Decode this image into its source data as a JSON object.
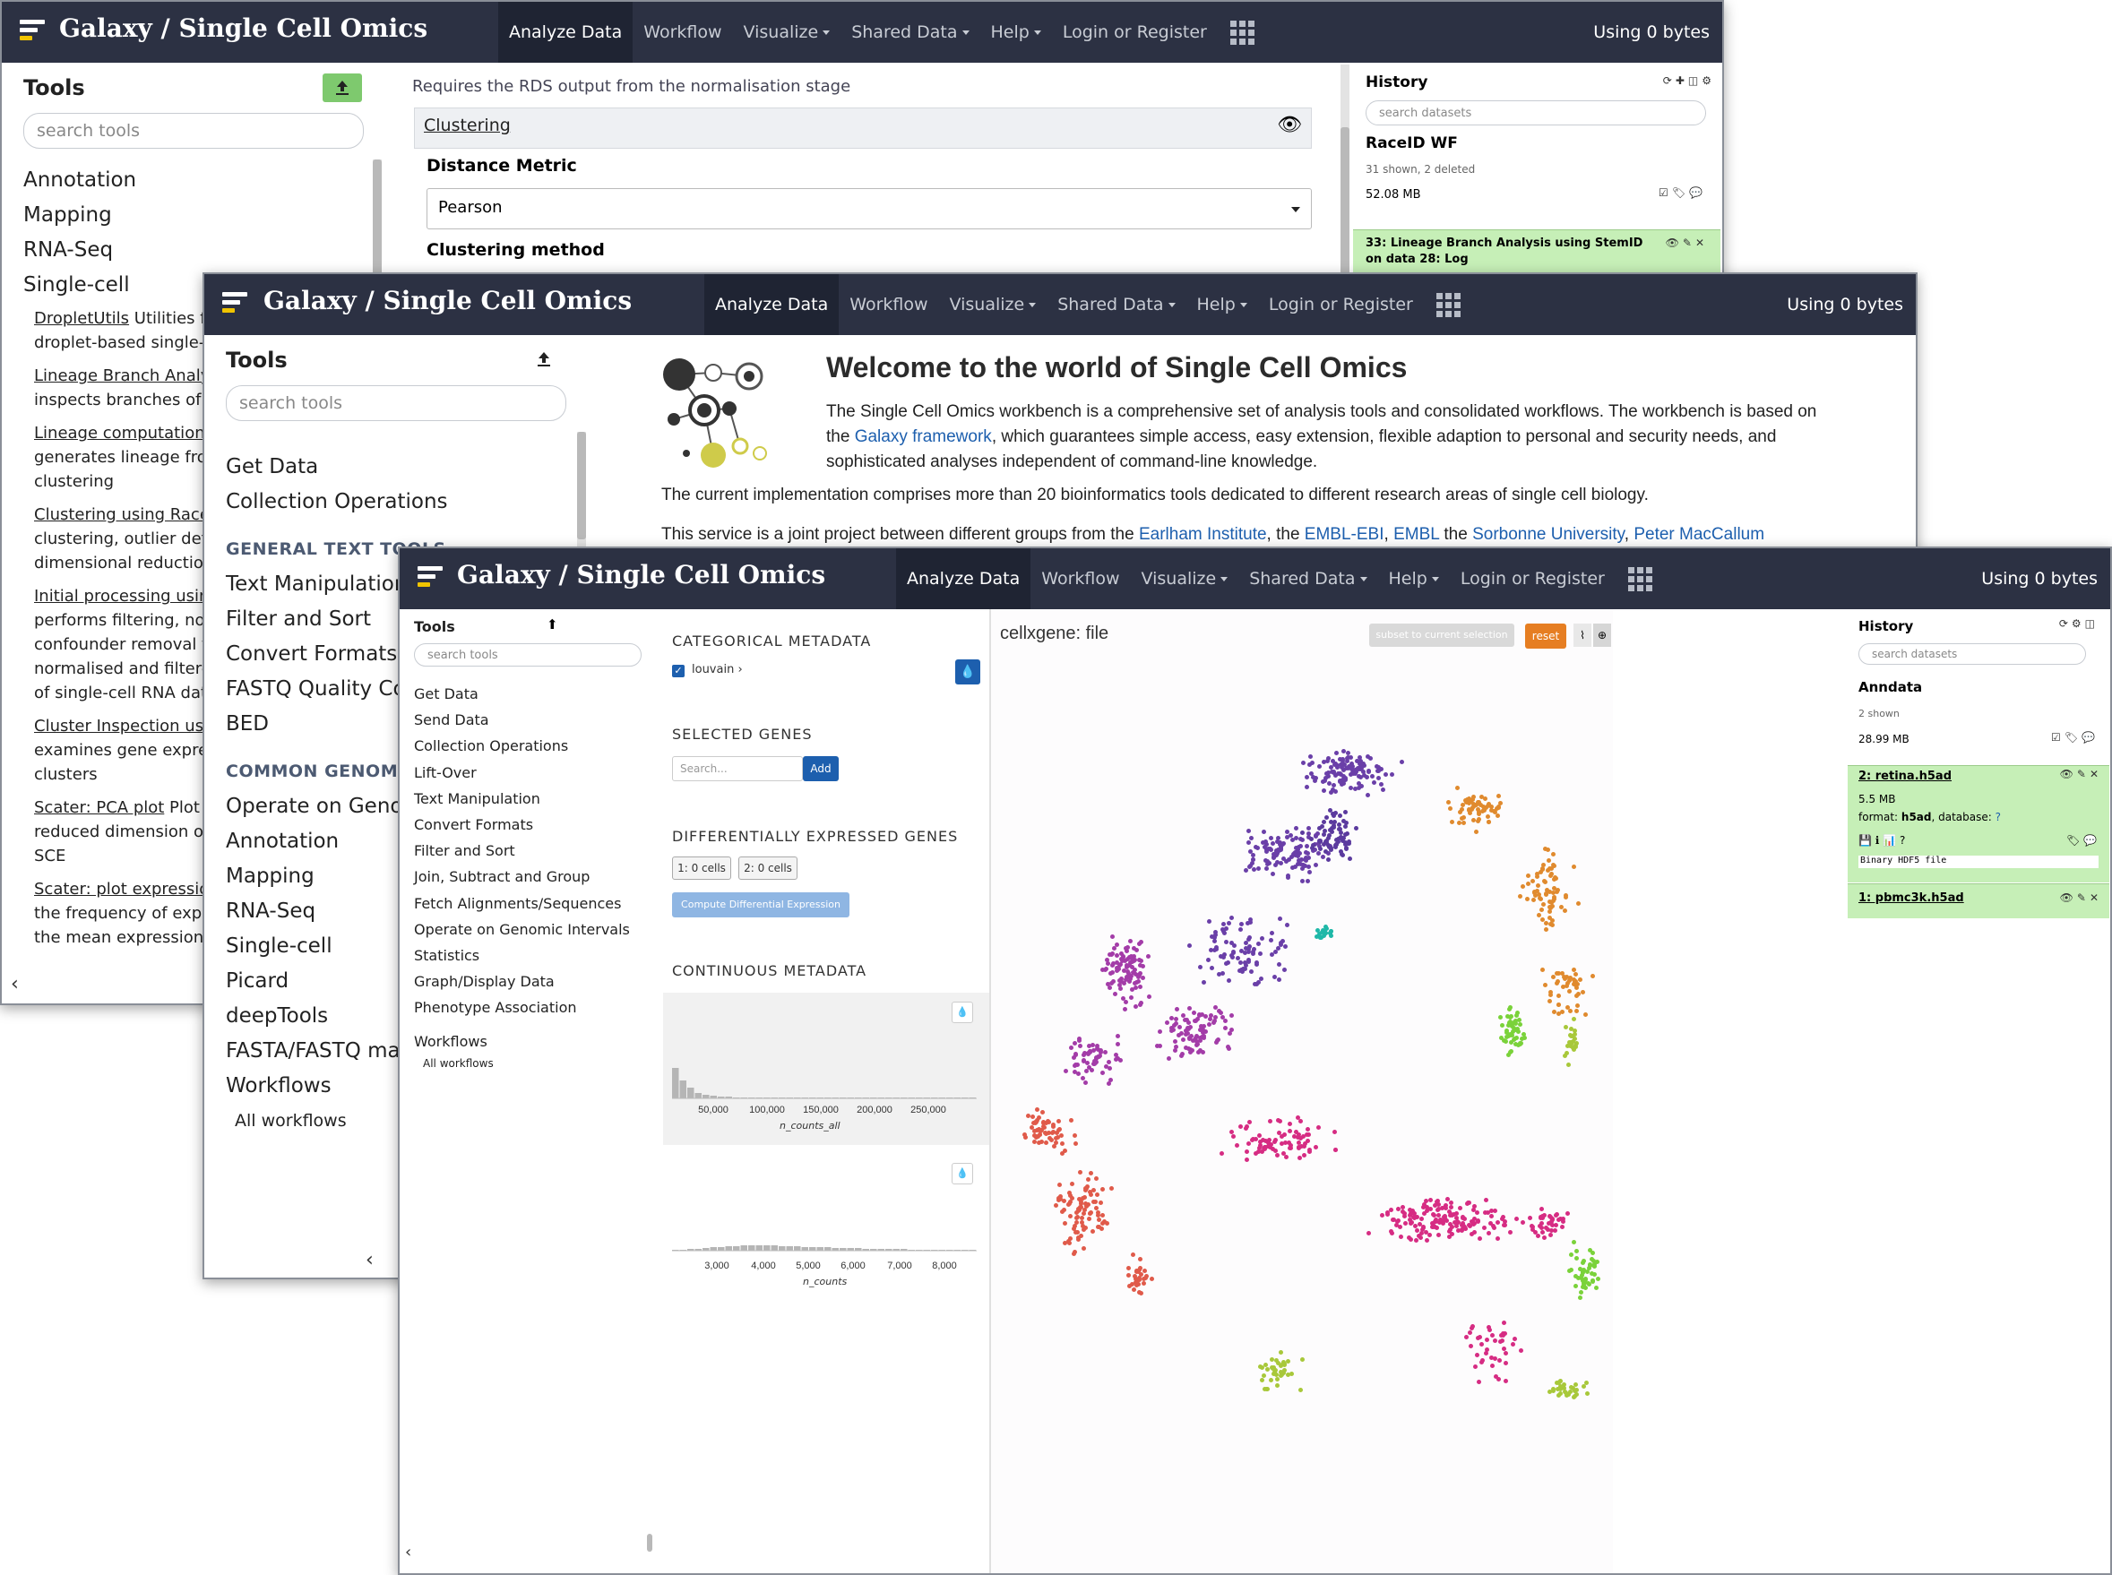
{
  "masthead": {
    "brand": "Galaxy / Single Cell Omics",
    "nav": [
      "Analyze Data",
      "Workflow",
      "Visualize",
      "Shared Data",
      "Help",
      "Login or Register"
    ],
    "using": "Using 0 bytes"
  },
  "colors": {
    "masthead": "#2c3143",
    "accent": "#1d5fae",
    "history_ok": "#c6efb7",
    "reset": "#e67e22"
  },
  "win1": {
    "tools_title": "Tools",
    "search_placeholder": "search tools",
    "categories": [
      "Annotation",
      "Mapping",
      "RNA-Seq",
      "Single-cell"
    ],
    "tools": [
      {
        "name": "DropletUtils",
        "desc1": " Utilities f",
        "desc2": "droplet-based single-c"
      },
      {
        "name": "Lineage Branch Analy",
        "desc1": "",
        "desc2": "inspects branches of a"
      },
      {
        "name": "Lineage computation",
        "desc1": "",
        "desc2": "generates lineage fro",
        "desc3": "clustering"
      },
      {
        "name": "Clustering using Race",
        "desc1": "",
        "desc2": "clustering, outlier det",
        "desc3": "dimensional reduction"
      },
      {
        "name": "Initial processing usin",
        "desc1": "",
        "desc2": "performs filtering, nor",
        "desc3": "confounder removal t",
        "desc4": "normalised and filtere",
        "desc5": "of single-cell RNA dat"
      },
      {
        "name": "Cluster Inspection usi",
        "desc1": "",
        "desc2": "examines gene expre",
        "desc3": "clusters"
      },
      {
        "name": "Scater: PCA plot",
        "desc1": " Plot",
        "desc2": "reduced dimension of",
        "desc3": "SCE"
      },
      {
        "name": "Scater: plot expressio",
        "desc1": "",
        "desc2": "the frequency of expr",
        "desc3": "the mean expression"
      }
    ],
    "form_note": "Requires the RDS output from the normalisation stage",
    "section": "Clustering",
    "distance_label": "Distance Metric",
    "distance_value": "Pearson",
    "clustering_label": "Clustering method",
    "history": {
      "title": "History",
      "search": "search datasets",
      "name": "RaceID WF",
      "shown": "31 shown, 2 deleted",
      "size": "52.08 MB",
      "item": "33: Lineage Branch Analysis using StemID on data 28: Log"
    }
  },
  "win2": {
    "tools_title": "Tools",
    "search_placeholder": "search tools",
    "items_top": [
      "Get Data",
      "Collection Operations"
    ],
    "section1": "GENERAL TEXT TOOLS",
    "items_mid": [
      "Text Manipulation",
      "Filter and Sort",
      "Convert Formats",
      "FASTQ Quality Co",
      "BED"
    ],
    "section2": "COMMON GENOMIC",
    "items_bot": [
      "Operate on Geno",
      "Annotation",
      "Mapping",
      "RNA-Seq",
      "Single-cell",
      "Picard",
      "deepTools",
      "FASTA/FASTQ ma",
      "Workflows"
    ],
    "all_workflows": "All workflows",
    "welcome": {
      "title": "Welcome to the world of Single Cell Omics",
      "p1a": "The Single Cell Omics workbench is a comprehensive set of analysis tools and consolidated workflows. The workbench is based on the ",
      "p1link": "Galaxy framework",
      "p1b": ", which guarantees simple access, easy extension, flexible adaption to personal and security needs, and sophisticated analyses independent of command-line knowledge.",
      "p2": "The current implementation comprises more than 20 bioinformatics tools dedicated to different research areas of single cell biology.",
      "p3a": "This service is a joint project between different groups from the ",
      "p3l1": "Earlham Institute",
      "p3b": ", the ",
      "p3l2": "EMBL-EBI",
      "p3c": ", ",
      "p3l3": "EMBL",
      "p3d": " the ",
      "p3l4": "Sorbonne University",
      "p3e": ", ",
      "p3l5": "Peter MacCallum"
    }
  },
  "win3": {
    "tools_title": "Tools",
    "search_placeholder": "search tools",
    "tools": [
      "Get Data",
      "Send Data",
      "Collection Operations",
      "Lift-Over",
      "Text Manipulation",
      "Convert Formats",
      "Filter and Sort",
      "Join, Subtract and Group",
      "Fetch Alignments/Sequences",
      "Operate on Genomic Intervals",
      "Statistics",
      "Graph/Display Data",
      "Phenotype Association"
    ],
    "workflows": "Workflows",
    "all_workflows": "All workflows",
    "cellxgene": {
      "categorical": "CATEGORICAL METADATA",
      "louvain": "louvain",
      "selected_genes": "SELECTED GENES",
      "gene_search": "Search...",
      "add": "Add",
      "diff": "DIFFERENTIALLY EXPRESSED GENES",
      "cells1": "1: 0 cells",
      "cells2": "2: 0 cells",
      "compute": "Compute Differential Expression",
      "continuous": "CONTINUOUS METADATA",
      "hist1_ticks": [
        "50,000",
        "100,000",
        "150,000",
        "200,000",
        "250,000"
      ],
      "hist1_label": "n_counts_all",
      "hist2_ticks": [
        "3,000",
        "4,000",
        "5,000",
        "6,000",
        "7,000",
        "8,000"
      ],
      "hist2_label": "n_counts",
      "plot_title": "cellxgene: file",
      "subset": "subset to current selection",
      "reset": "reset"
    },
    "history": {
      "title": "History",
      "search": "search datasets",
      "name": "Anndata",
      "shown": "2 shown",
      "size": "28.99 MB",
      "item1": "2: retina.h5ad",
      "item1_size": "5.5 MB",
      "item1_format_label": "format: ",
      "item1_format": "h5ad",
      "item1_db_label": ", database: ",
      "item1_db": "?",
      "item1_peek": "Binary HDF5 file",
      "item2": "1: pbmc3k.h5ad"
    }
  }
}
